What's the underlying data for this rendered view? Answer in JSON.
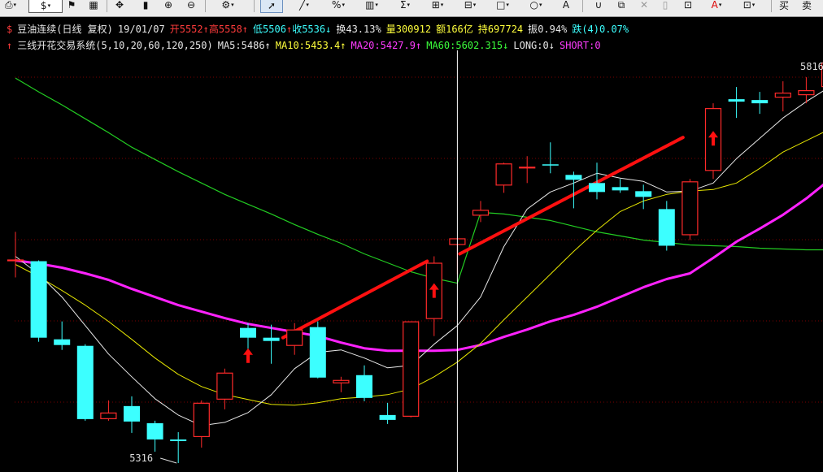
{
  "toolbar": {
    "right_buttons": [
      "买",
      "卖"
    ]
  },
  "header": {
    "symbol_icon": "$",
    "name": "豆油连续(日线 复权)",
    "date": "19/01/07",
    "open_label": "开",
    "open": "5552",
    "high_label": "高",
    "high": "5558",
    "low_label": "低",
    "low": "5506",
    "close_label": "收",
    "close": "5536",
    "turnover_label": "换",
    "turnover": "43.13%",
    "volume_label": "量",
    "volume": "300912",
    "amount_label": "额",
    "amount": "166亿",
    "oi_label": "持",
    "oi": "697724",
    "amplitude_label": "振",
    "amplitude": "0.94%",
    "change_label": "跌",
    "change": "(4)0.07%"
  },
  "indicator": {
    "name": "三线开花交易系统(5,10,20,60,120,250)",
    "ma5_label": "MA5:",
    "ma5": "5486",
    "ma10_label": "MA10:",
    "ma10": "5453.4",
    "ma20_label": "MA20:",
    "ma20": "5427.9",
    "ma60_label": "MA60:",
    "ma60": "5602.315",
    "long_label": "LONG:",
    "long": "0",
    "short_label": "SHORT:",
    "short": "0"
  },
  "colors": {
    "up": "#ff2a2a",
    "down": "#3cffff",
    "ma5": "#e8e8e8",
    "ma10": "#e6e600",
    "ma20": "#ff22ff",
    "ma60": "#22cc22",
    "signal": "#ff1010",
    "crosshair": "#ffffff"
  },
  "chart_data": {
    "type": "candlestick",
    "ylim": [
      5305,
      5825
    ],
    "price_labels": [
      "5816",
      "5316"
    ],
    "low_marker": "5316",
    "crosshair_index": 19,
    "candles": [
      {
        "o": 5565,
        "h": 5600,
        "l": 5544,
        "c": 5566
      },
      {
        "o": 5564,
        "h": 5565,
        "l": 5465,
        "c": 5470
      },
      {
        "o": 5468,
        "h": 5490,
        "l": 5455,
        "c": 5461
      },
      {
        "o": 5460,
        "h": 5462,
        "l": 5368,
        "c": 5370
      },
      {
        "o": 5370,
        "h": 5393,
        "l": 5368,
        "c": 5378
      },
      {
        "o": 5386,
        "h": 5398,
        "l": 5353,
        "c": 5367
      },
      {
        "o": 5365,
        "h": 5368,
        "l": 5330,
        "c": 5345
      },
      {
        "o": 5345,
        "h": 5354,
        "l": 5316,
        "c": 5343
      },
      {
        "o": 5348,
        "h": 5393,
        "l": 5335,
        "c": 5390
      },
      {
        "o": 5394,
        "h": 5432,
        "l": 5382,
        "c": 5427
      },
      {
        "o": 5482,
        "h": 5488,
        "l": 5440,
        "c": 5470
      },
      {
        "o": 5470,
        "h": 5486,
        "l": 5438,
        "c": 5466
      },
      {
        "o": 5460,
        "h": 5488,
        "l": 5449,
        "c": 5480
      },
      {
        "o": 5483,
        "h": 5490,
        "l": 5420,
        "c": 5421
      },
      {
        "o": 5414,
        "h": 5422,
        "l": 5403,
        "c": 5418
      },
      {
        "o": 5424,
        "h": 5436,
        "l": 5392,
        "c": 5396
      },
      {
        "o": 5375,
        "h": 5390,
        "l": 5364,
        "c": 5369
      },
      {
        "o": 5373,
        "h": 5490,
        "l": 5372,
        "c": 5490
      },
      {
        "o": 5493,
        "h": 5570,
        "l": 5472,
        "c": 5562
      },
      {
        "o": 5584,
        "h": 5592,
        "l": 5548,
        "c": 5592
      },
      {
        "o": 5620,
        "h": 5638,
        "l": 5612,
        "c": 5627
      },
      {
        "o": 5657,
        "h": 5685,
        "l": 5648,
        "c": 5684
      },
      {
        "o": 5678,
        "h": 5693,
        "l": 5660,
        "c": 5680
      },
      {
        "o": 5683,
        "h": 5710,
        "l": 5672,
        "c": 5682
      },
      {
        "o": 5670,
        "h": 5674,
        "l": 5629,
        "c": 5664
      },
      {
        "o": 5660,
        "h": 5685,
        "l": 5640,
        "c": 5649
      },
      {
        "o": 5655,
        "h": 5665,
        "l": 5648,
        "c": 5651
      },
      {
        "o": 5650,
        "h": 5658,
        "l": 5628,
        "c": 5643
      },
      {
        "o": 5628,
        "h": 5638,
        "l": 5577,
        "c": 5583
      },
      {
        "o": 5596,
        "h": 5665,
        "l": 5590,
        "c": 5662
      },
      {
        "o": 5675,
        "h": 5758,
        "l": 5665,
        "c": 5752
      },
      {
        "o": 5763,
        "h": 5778,
        "l": 5740,
        "c": 5760
      },
      {
        "o": 5762,
        "h": 5772,
        "l": 5745,
        "c": 5758
      },
      {
        "o": 5765,
        "h": 5785,
        "l": 5748,
        "c": 5771
      },
      {
        "o": 5768,
        "h": 5790,
        "l": 5758,
        "c": 5774
      },
      {
        "o": 5778,
        "h": 5810,
        "l": 5760,
        "c": 5808
      }
    ],
    "ma5": [
      5570,
      5548,
      5520,
      5485,
      5450,
      5422,
      5395,
      5375,
      5362,
      5366,
      5378,
      5400,
      5432,
      5452,
      5455,
      5445,
      5433,
      5436,
      5462,
      5485,
      5520,
      5582,
      5628,
      5649,
      5660,
      5672,
      5666,
      5662,
      5649,
      5650,
      5660,
      5690,
      5715,
      5740,
      5760,
      5778
    ],
    "ma10": [
      5560,
      5545,
      5528,
      5510,
      5490,
      5468,
      5445,
      5425,
      5410,
      5400,
      5394,
      5388,
      5387,
      5390,
      5395,
      5397,
      5400,
      5407,
      5422,
      5440,
      5463,
      5492,
      5520,
      5548,
      5576,
      5602,
      5625,
      5638,
      5646,
      5650,
      5652,
      5660,
      5678,
      5698,
      5712,
      5726
    ],
    "ma20": [
      5565,
      5561,
      5556,
      5549,
      5541,
      5530,
      5520,
      5510,
      5502,
      5494,
      5487,
      5482,
      5477,
      5472,
      5464,
      5457,
      5454,
      5454,
      5454,
      5455,
      5461,
      5471,
      5480,
      5490,
      5498,
      5508,
      5520,
      5532,
      5542,
      5549,
      5568,
      5588,
      5604,
      5621,
      5641,
      5664
    ],
    "ma60": [
      5789,
      5772,
      5756,
      5739,
      5722,
      5704,
      5689,
      5674,
      5660,
      5646,
      5634,
      5622,
      5609,
      5597,
      5586,
      5573,
      5562,
      5551,
      5543,
      5537,
      5624,
      5622,
      5618,
      5614,
      5607,
      5600,
      5595,
      5590,
      5587,
      5584,
      5583,
      5582,
      5580,
      5579,
      5578,
      5578
    ],
    "signal_lines": [
      {
        "from_index": 11.5,
        "from_value": 5470,
        "to_index": 17.7,
        "to_value": 5564
      },
      {
        "from_index": 19.1,
        "from_value": 5573,
        "to_index": 28.7,
        "to_value": 5716
      }
    ],
    "buy_arrows": [
      {
        "index": 10,
        "value": 5448
      },
      {
        "index": 18,
        "value": 5528
      },
      {
        "index": 30,
        "value": 5715
      }
    ]
  }
}
